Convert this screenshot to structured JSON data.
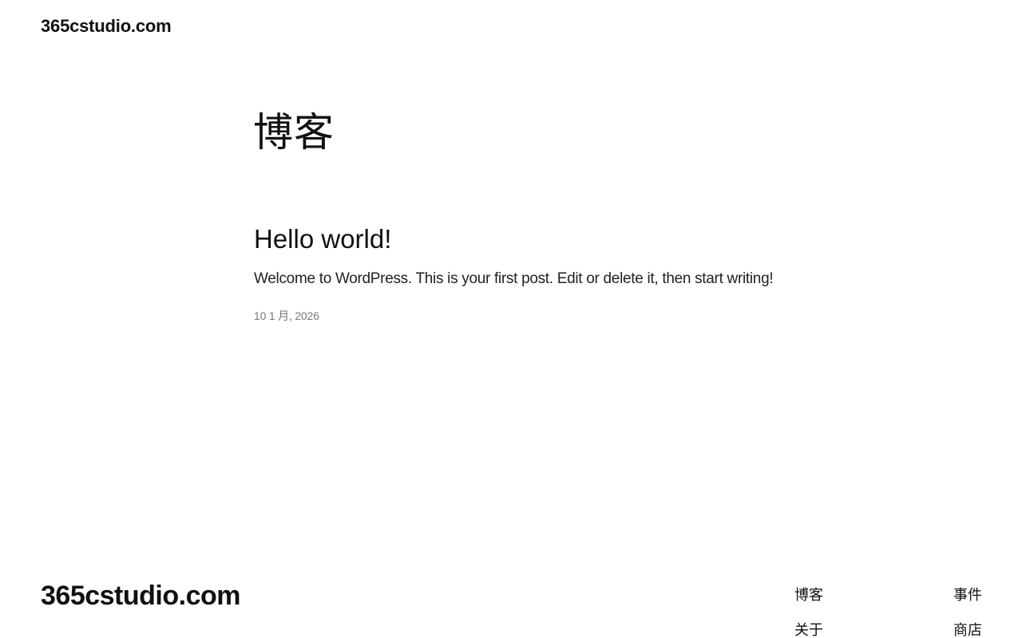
{
  "header": {
    "site_title": "365cstudio.com"
  },
  "main": {
    "page_title": "博客",
    "posts": [
      {
        "title": "Hello world!",
        "excerpt": "Welcome to WordPress. This is your first post. Edit or delete it, then start writing!",
        "date": "10 1 月, 2026"
      }
    ]
  },
  "footer": {
    "site_title": "365cstudio.com",
    "nav": [
      {
        "label": "博客"
      },
      {
        "label": "事件"
      },
      {
        "label": "关于"
      },
      {
        "label": "商店"
      }
    ]
  }
}
